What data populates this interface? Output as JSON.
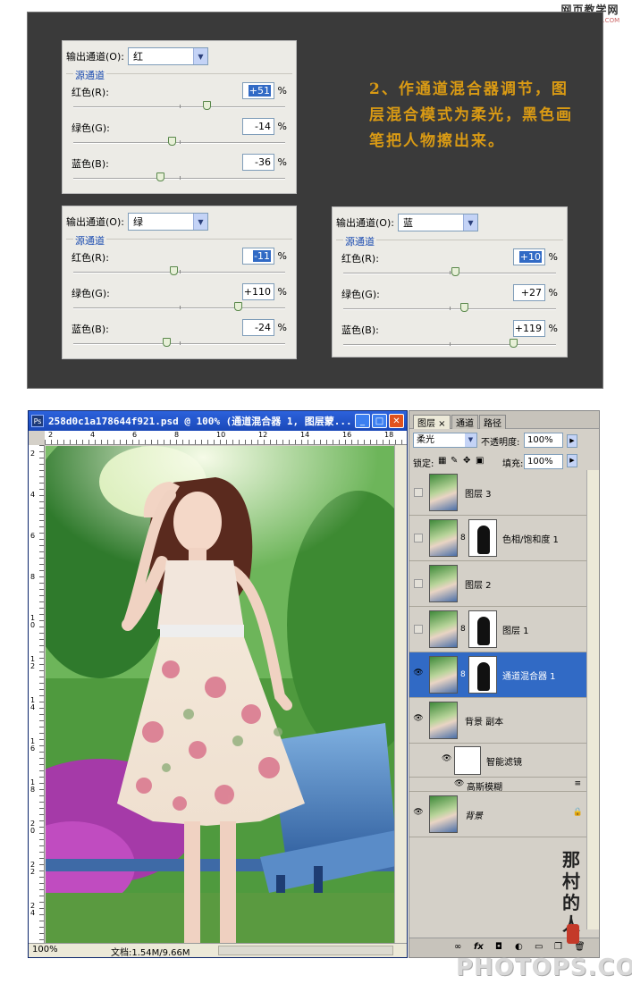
{
  "watermark_top": {
    "line1": "网页教学网",
    "line2": "WWW.WEB3X.COM"
  },
  "mixers": [
    {
      "output_label": "输出通道(O):",
      "channel": "红",
      "group": "源通道",
      "rows": [
        {
          "label": "红色(R):",
          "value": "+51",
          "pct": "%",
          "level": 0.628,
          "selected": true
        },
        {
          "label": "绿色(G):",
          "value": "-14",
          "pct": "%",
          "level": 0.465,
          "selected": false
        },
        {
          "label": "蓝色(B):",
          "value": "-36",
          "pct": "%",
          "level": 0.41,
          "selected": false
        }
      ]
    },
    {
      "output_label": "输出通道(O):",
      "channel": "绿",
      "group": "源通道",
      "rows": [
        {
          "label": "红色(R):",
          "value": "-11",
          "pct": "%",
          "level": 0.473,
          "selected": true
        },
        {
          "label": "绿色(G):",
          "value": "+110",
          "pct": "%",
          "level": 0.775,
          "selected": false
        },
        {
          "label": "蓝色(B):",
          "value": "-24",
          "pct": "%",
          "level": 0.44,
          "selected": false
        }
      ]
    },
    {
      "output_label": "输出通道(O):",
      "channel": "蓝",
      "group": "源通道",
      "rows": [
        {
          "label": "红色(R):",
          "value": "+10",
          "pct": "%",
          "level": 0.525,
          "selected": true
        },
        {
          "label": "绿色(G):",
          "value": "+27",
          "pct": "%",
          "level": 0.568,
          "selected": false
        },
        {
          "label": "蓝色(B):",
          "value": "+119",
          "pct": "%",
          "level": 0.798,
          "selected": false
        }
      ]
    }
  ],
  "note": "2、作通道混合器调节，图层混合模式为柔光，黑色画笔把人物擦出来。",
  "doc": {
    "title": "258d0c1a178644f921.psd @ 100% (通道混合器 1, 图层蒙...",
    "ruler_top": [
      "2",
      "4",
      "6",
      "8",
      "10",
      "12",
      "14",
      "16",
      "18"
    ],
    "ruler_left": [
      "2",
      "4",
      "6",
      "8",
      "10",
      "12",
      "14",
      "16",
      "18",
      "20",
      "22",
      "24"
    ],
    "zoom": "100%",
    "info": "文档:1.54M/9.66M"
  },
  "layers_panel": {
    "tabs": [
      "图层 ×",
      "通道",
      "路径"
    ],
    "blend_mode": "柔光",
    "opacity_label": "不透明度:",
    "opacity": "100%",
    "lock_label": "锁定:",
    "fill_label": "填充:",
    "fill": "100%",
    "layers": [
      {
        "name": "图层 3",
        "visible": false,
        "selected": false,
        "mask": false,
        "italic": false
      },
      {
        "name": "色相/饱和度 1",
        "visible": false,
        "selected": false,
        "mask": true,
        "italic": false
      },
      {
        "name": "图层 2",
        "visible": false,
        "selected": false,
        "mask": false,
        "italic": false
      },
      {
        "name": "图层 1",
        "visible": false,
        "selected": false,
        "mask": true,
        "italic": false
      },
      {
        "name": "通道混合器 1",
        "visible": true,
        "selected": true,
        "mask": true,
        "italic": false
      },
      {
        "name": "背景 副本",
        "visible": true,
        "selected": false,
        "mask": false,
        "italic": false
      },
      {
        "name": "背景",
        "visible": true,
        "selected": false,
        "mask": false,
        "italic": true
      }
    ],
    "smart_filter": "智能滤镜",
    "gaussian_blur": "高斯模糊",
    "footer_icons": [
      "link-icon",
      "fx-icon",
      "mask-icon",
      "adjustment-icon",
      "folder-icon",
      "new-layer-icon",
      "trash-icon"
    ]
  },
  "watermark_bottom": "PHOTOPS.COM"
}
